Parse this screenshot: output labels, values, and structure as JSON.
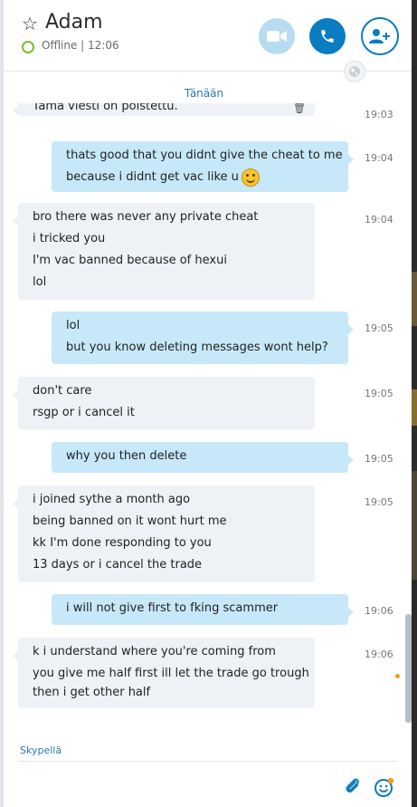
{
  "contact": {
    "name": "Adam",
    "status": "Offline | 12:06"
  },
  "date_separator": "Tänään",
  "messages": [
    {
      "dir": "in",
      "lines": [
        "Tämä viesti on poistettu."
      ],
      "time": "19:03"
    },
    {
      "dir": "out",
      "lines": [
        "thats good that you didnt give the cheat to me",
        "because i didnt get vac like u"
      ],
      "time": "19:04"
    },
    {
      "dir": "in",
      "lines": [
        "bro there was never any private cheat",
        "i tricked you",
        "I'm vac banned because of hexui",
        "lol"
      ],
      "time": "19:04"
    },
    {
      "dir": "out",
      "lines": [
        "lol",
        "but you know deleting messages wont help?"
      ],
      "time": "19:05"
    },
    {
      "dir": "in",
      "lines": [
        "don't care",
        "rsgp or i cancel it"
      ],
      "time": "19:05"
    },
    {
      "dir": "out",
      "lines": [
        "why you then delete"
      ],
      "time": "19:05"
    },
    {
      "dir": "in",
      "lines": [
        "i joined sythe a month ago",
        "being banned on it wont hurt me",
        "kk I'm done responding to you",
        "13 days or i cancel the trade"
      ],
      "time": "19:05"
    },
    {
      "dir": "out",
      "lines": [
        "i will not give first to fking scammer"
      ],
      "time": "19:06"
    },
    {
      "dir": "in",
      "lines": [
        "k i understand where you're coming from",
        "you give me half first ill let the trade go trough",
        "then i get other half"
      ],
      "time": "19:06"
    }
  ],
  "composer": {
    "label": "Skypellä",
    "value": ""
  },
  "icons": {
    "favorite": "star-outline-icon",
    "presence": "presence-offline-icon",
    "video": "video-call-icon",
    "call": "phone-call-icon",
    "add": "add-person-icon",
    "globe": "globe-icon",
    "delete": "trash-icon",
    "attach": "paperclip-icon",
    "emoticon": "emoticon-icon"
  },
  "colors": {
    "accent": "#0a7cc1",
    "incoming": "#eef1f5",
    "outgoing": "#c7e8f9",
    "online_ring": "#7dbb2a",
    "unread": "#f39a1f"
  }
}
